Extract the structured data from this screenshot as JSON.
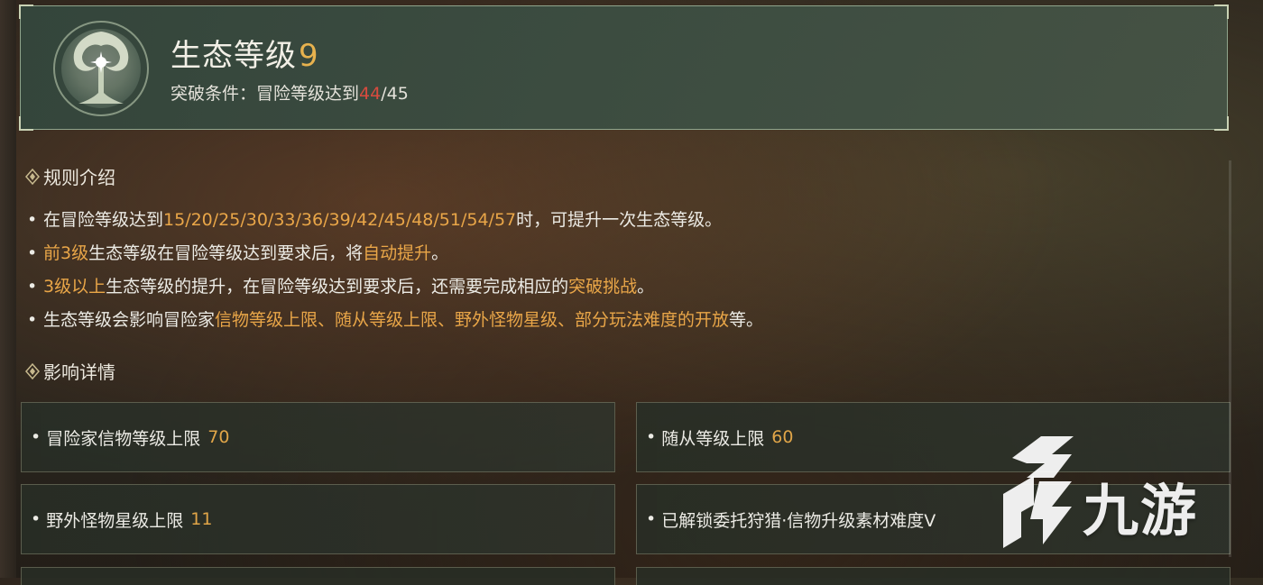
{
  "header": {
    "title": "生态等级",
    "level": "9",
    "condition_label": "突破条件：冒险等级达到",
    "condition_current": "44",
    "condition_sep": "/",
    "condition_required": "45"
  },
  "rules_section": {
    "title": "规则介绍",
    "items": [
      {
        "segments": [
          {
            "t": "在冒险等级达到",
            "hl": false
          },
          {
            "t": "15/20/25/30/33/36/39/42/45/48/51/54/57",
            "hl": true
          },
          {
            "t": "时，可提升一次生态等级。",
            "hl": false
          }
        ]
      },
      {
        "segments": [
          {
            "t": "前3级",
            "hl": true
          },
          {
            "t": "生态等级在冒险等级达到要求后，将",
            "hl": false
          },
          {
            "t": "自动提升",
            "hl": true
          },
          {
            "t": "。",
            "hl": false
          }
        ]
      },
      {
        "segments": [
          {
            "t": "3级以上",
            "hl": true
          },
          {
            "t": "生态等级的提升，在冒险等级达到要求后，还需要完成相应的",
            "hl": false
          },
          {
            "t": "突破挑战",
            "hl": true
          },
          {
            "t": "。",
            "hl": false
          }
        ]
      },
      {
        "segments": [
          {
            "t": "生态等级会影响冒险家",
            "hl": false
          },
          {
            "t": "信物等级上限、随从等级上限、野外怪物星级、部分玩法难度的开放",
            "hl": true
          },
          {
            "t": "等。",
            "hl": false
          }
        ]
      }
    ]
  },
  "effects_section": {
    "title": "影响详情",
    "cards": [
      {
        "label": "冒险家信物等级上限",
        "value": "70"
      },
      {
        "label": "随从等级上限",
        "value": "60"
      },
      {
        "label": "野外怪物星级上限",
        "value": "11"
      },
      {
        "label": "已解锁委托狩猎·信物升级素材难度V",
        "value": ""
      }
    ]
  },
  "watermark": {
    "text": "九游"
  },
  "colors": {
    "accent": "#e9a648",
    "level": "#e7b24e",
    "warning": "#d84b3e",
    "header_bg": "#3f5547"
  }
}
